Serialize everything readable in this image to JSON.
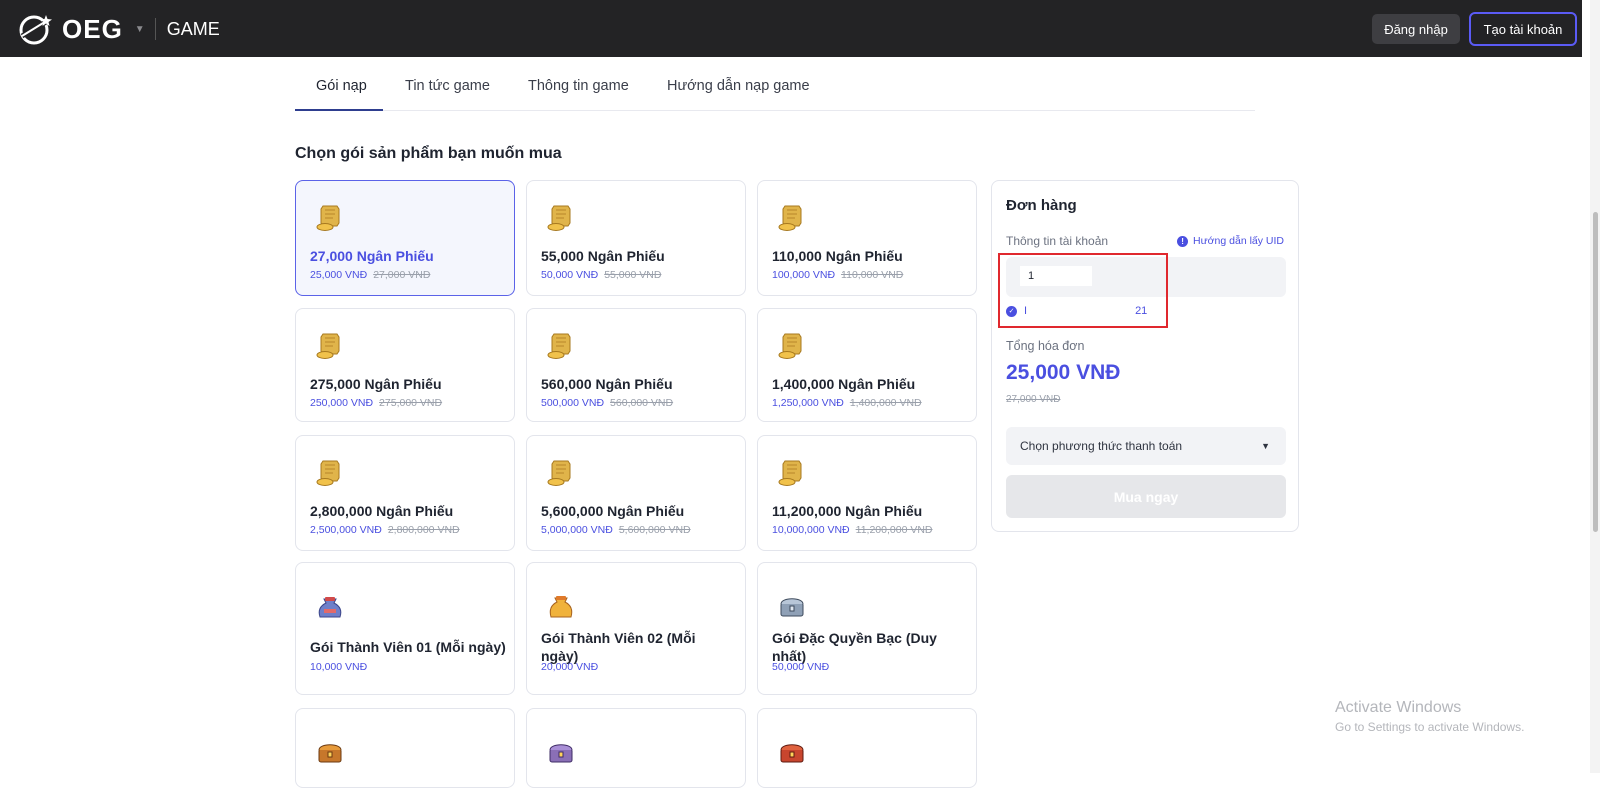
{
  "header": {
    "logo_text": "OEG",
    "section": "GAME",
    "login_label": "Đăng nhập",
    "signup_label": "Tạo tài khoản"
  },
  "tabs": [
    {
      "label": "Gói nạp",
      "active": true
    },
    {
      "label": "Tin tức game",
      "active": false
    },
    {
      "label": "Thông tin game",
      "active": false
    },
    {
      "label": "Hướng dẫn nạp game",
      "active": false
    }
  ],
  "section_title": "Chọn gói sản phẩm bạn muốn mua",
  "packages": [
    {
      "name": "27,000 Ngân Phiếu",
      "price": "25,000 VNĐ",
      "old_price": "27,000 VNĐ",
      "icon": "gold-ingot-icon",
      "selected": true
    },
    {
      "name": "55,000 Ngân Phiếu",
      "price": "50,000 VNĐ",
      "old_price": "55,000 VNĐ",
      "icon": "gold-ingot-icon"
    },
    {
      "name": "110,000 Ngân Phiếu",
      "price": "100,000 VNĐ",
      "old_price": "110,000 VNĐ",
      "icon": "gold-ingot-icon"
    },
    {
      "name": "275,000 Ngân Phiếu",
      "price": "250,000 VNĐ",
      "old_price": "275,000 VNĐ",
      "icon": "gold-ingot-icon"
    },
    {
      "name": "560,000 Ngân Phiếu",
      "price": "500,000 VNĐ",
      "old_price": "560,000 VNĐ",
      "icon": "gold-ingot-icon"
    },
    {
      "name": "1,400,000 Ngân Phiếu",
      "price": "1,250,000 VNĐ",
      "old_price": "1,400,000 VNĐ",
      "icon": "gold-ingot-icon"
    },
    {
      "name": "2,800,000 Ngân Phiếu",
      "price": "2,500,000 VNĐ",
      "old_price": "2,800,000 VNĐ",
      "icon": "gold-ingot-icon"
    },
    {
      "name": "5,600,000 Ngân Phiếu",
      "price": "5,000,000 VNĐ",
      "old_price": "5,600,000 VNĐ",
      "icon": "gold-ingot-icon"
    },
    {
      "name": "11,200,000 Ngân Phiếu",
      "price": "10,000,000 VNĐ",
      "old_price": "11,200,000 VNĐ",
      "icon": "gold-ingot-icon"
    },
    {
      "name": "Gói Thành Viên 01 (Mỗi ngày)",
      "price": "10,000 VNĐ",
      "old_price": "",
      "icon": "blue-pouch-icon"
    },
    {
      "name": "Gói Thành Viên 02 (Mỗi ngày)",
      "price": "20,000 VNĐ",
      "old_price": "",
      "icon": "gold-pouch-icon"
    },
    {
      "name": "Gói Đặc Quyền Bạc (Duy nhất)",
      "price": "50,000 VNĐ",
      "old_price": "",
      "icon": "silver-chest-icon"
    },
    {
      "name": "",
      "price": "",
      "old_price": "",
      "icon": "gold-chest-icon"
    },
    {
      "name": "",
      "price": "",
      "old_price": "",
      "icon": "purple-chest-icon"
    },
    {
      "name": "",
      "price": "",
      "old_price": "",
      "icon": "red-chest-icon"
    }
  ],
  "order": {
    "title": "Đơn hàng",
    "account_label": "Thông tin tài khoản",
    "uid_help": "Hướng dẫn lấy UID",
    "uid_value": "1",
    "verify_text": "I",
    "verify_suffix": "21",
    "total_label": "Tổng hóa đơn",
    "total_value": "25,000 VNĐ",
    "total_old": "27,000 VNĐ",
    "payment_placeholder": "Chọn phương thức thanh toán",
    "buy_label": "Mua ngay"
  },
  "watermark": {
    "line1": "Activate Windows",
    "line2": "Go to Settings to activate Windows."
  },
  "colors": {
    "accent": "#4a4fe0",
    "header_bg": "#232325",
    "highlight_box": "#e0282e"
  }
}
